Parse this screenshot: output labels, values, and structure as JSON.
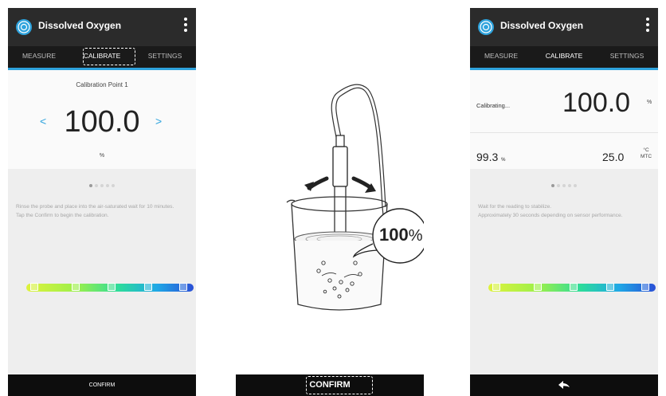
{
  "left_screen": {
    "app_title": "Dissolved Oxygen",
    "tabs": [
      "MEASURE",
      "CALIBRATE",
      "SETTINGS"
    ],
    "active_tab": "CALIBRATE",
    "calibration_point_label": "Calibration Point 1",
    "prev_glyph": "<",
    "next_glyph": ">",
    "value": "100.0",
    "unit": "%",
    "page_indicator": {
      "total": 5,
      "active_index": 0
    },
    "instructions": [
      "Rinse the probe and place into the air-saturated wait for 10 minutes.",
      "Tap the Confirm to begin the calibration."
    ],
    "gradient_markers": 5,
    "confirm_label": "CONFIRM"
  },
  "center": {
    "percent_value": "100",
    "percent_sign": "%",
    "confirm_label": "CONFIRM"
  },
  "right_screen": {
    "app_title": "Dissolved Oxygen",
    "tabs": [
      "MEASURE",
      "CALIBRATE",
      "SETTINGS"
    ],
    "active_tab": "CALIBRATE",
    "status_label": "Calibrating...",
    "value": "100.0",
    "unit": "%",
    "reading_value": "99.3",
    "reading_unit": "%",
    "temp_value": "25.0",
    "temp_unit": "°C",
    "temp_mode": "MTC",
    "page_indicator": {
      "total": 5,
      "active_index": 0
    },
    "instructions": [
      "Wait for the reading to stabilize.",
      "Approximately 30 seconds depending on sensor performance."
    ],
    "gradient_markers": 5,
    "back_icon": "back-arrow-icon"
  },
  "colors": {
    "appbar": "#2b2b2b",
    "tabbar": "#1a1a1a",
    "accent": "#2ea3dd",
    "bottom_bar": "#0d0d0d"
  }
}
